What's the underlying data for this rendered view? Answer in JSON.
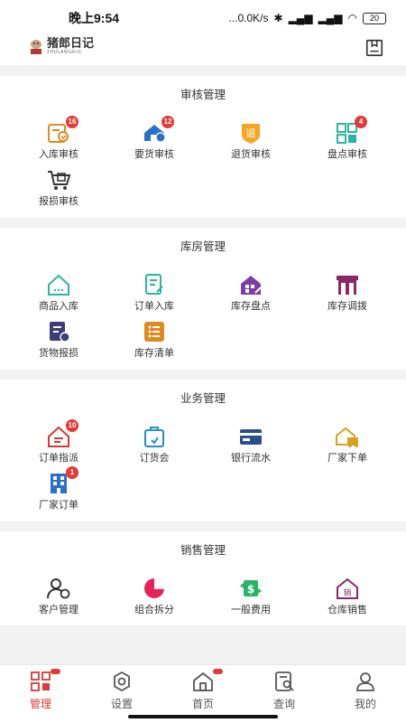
{
  "status_bar": {
    "time": "晚上9:54",
    "network": "...0.0K/s",
    "battery": "20"
  },
  "header": {
    "logo_title": "猪郎日记",
    "logo_sub": "ZHULANGRIJI"
  },
  "sections": [
    {
      "title": "审核管理",
      "items": [
        {
          "label": "入库审核",
          "icon": "inbound-review-icon",
          "badge": "16"
        },
        {
          "label": "要货审核",
          "icon": "request-review-icon",
          "badge": "12"
        },
        {
          "label": "退货审核",
          "icon": "return-review-icon",
          "badge": ""
        },
        {
          "label": "盘点审核",
          "icon": "stocktake-review-icon",
          "badge": "4"
        },
        {
          "label": "报损审核",
          "icon": "loss-review-icon",
          "badge": ""
        }
      ]
    },
    {
      "title": "库房管理",
      "items": [
        {
          "label": "商品入库",
          "icon": "goods-inbound-icon",
          "badge": ""
        },
        {
          "label": "订单入库",
          "icon": "order-inbound-icon",
          "badge": ""
        },
        {
          "label": "库存盘点",
          "icon": "stocktake-icon",
          "badge": ""
        },
        {
          "label": "库存调拨",
          "icon": "transfer-icon",
          "badge": ""
        },
        {
          "label": "货物报损",
          "icon": "goods-loss-icon",
          "badge": ""
        },
        {
          "label": "库存清单",
          "icon": "stock-list-icon",
          "badge": ""
        }
      ]
    },
    {
      "title": "业务管理",
      "items": [
        {
          "label": "订单指派",
          "icon": "order-assign-icon",
          "badge": "10"
        },
        {
          "label": "订货会",
          "icon": "order-fair-icon",
          "badge": ""
        },
        {
          "label": "银行流水",
          "icon": "bank-statement-icon",
          "badge": ""
        },
        {
          "label": "厂家下单",
          "icon": "factory-order-place-icon",
          "badge": ""
        },
        {
          "label": "厂家订单",
          "icon": "factory-orders-icon",
          "badge": "1"
        }
      ]
    },
    {
      "title": "销售管理",
      "items": [
        {
          "label": "客户管理",
          "icon": "customer-icon",
          "badge": ""
        },
        {
          "label": "组合拆分",
          "icon": "combo-split-icon",
          "badge": ""
        },
        {
          "label": "一般费用",
          "icon": "expense-icon",
          "badge": ""
        },
        {
          "label": "仓库销售",
          "icon": "warehouse-sales-icon",
          "badge": ""
        }
      ]
    }
  ],
  "tabs": [
    {
      "label": "管理",
      "icon": "grid-icon",
      "active": true
    },
    {
      "label": "设置",
      "icon": "settings-icon",
      "active": false
    },
    {
      "label": "首页",
      "icon": "home-icon",
      "active": false
    },
    {
      "label": "查询",
      "icon": "search-doc-icon",
      "active": false
    },
    {
      "label": "我的",
      "icon": "user-icon",
      "active": false
    }
  ],
  "colors": {
    "accent": "#d93838",
    "badge": "#e53935",
    "background": "#f2f2f2"
  }
}
